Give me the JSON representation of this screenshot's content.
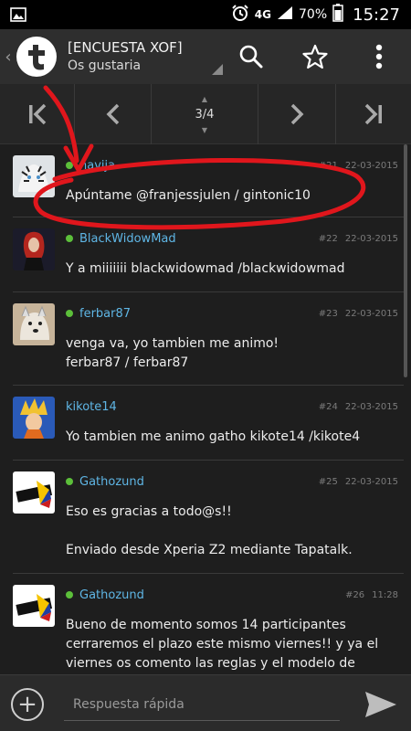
{
  "status_bar": {
    "network": "4G",
    "battery_percent": "70%",
    "time": "15:27"
  },
  "header": {
    "title": "[ENCUESTA XOF]",
    "subtitle": "Os gustaria"
  },
  "icons": {
    "back": "chevron-left-icon",
    "logo": "tapatalk-logo",
    "search": "search-icon",
    "favorite": "star-icon",
    "menu": "more-vert-icon",
    "first": "first-page-icon",
    "prev": "chevron-left-icon",
    "next": "chevron-right-icon",
    "last": "last-page-icon",
    "attach": "plus-circle-icon",
    "send": "send-icon"
  },
  "pagination": {
    "indicator": "3/4"
  },
  "posts": [
    {
      "username": "navija",
      "online": true,
      "number": "#21",
      "date": "22-03-2015",
      "body": "Apúntame @franjessjulen / gintonic10"
    },
    {
      "username": "BlackWidowMad",
      "online": true,
      "number": "#22",
      "date": "22-03-2015",
      "body": "Y a miiiiiii blackwidowmad /blackwidowmad"
    },
    {
      "username": "ferbar87",
      "online": true,
      "number": "#23",
      "date": "22-03-2015",
      "body": "venga va, yo tambien me animo!\nferbar87 / ferbar87"
    },
    {
      "username": "kikote14",
      "online": false,
      "number": "#24",
      "date": "22-03-2015",
      "body": "Yo tambien me animo gatho kikote14 /kikote4"
    },
    {
      "username": "Gathozund",
      "online": true,
      "number": "#25",
      "date": "22-03-2015",
      "body": "Eso es gracias a todo@s!!\n\nEnviado desde Xperia Z2 mediante Tapatalk."
    },
    {
      "username": "Gathozund",
      "online": true,
      "number": "#26",
      "date": "11:28",
      "body": "Bueno de momento somos 14 participantes cerraremos el plazo este mismo viernes!! y ya el viernes os comento las reglas y el modelo de torneo."
    }
  ],
  "reply": {
    "placeholder": "Respuesta rápida"
  },
  "colors": {
    "accent_username": "#5fb6e5",
    "online": "#5cbf3a",
    "annotation": "#e0161c"
  }
}
